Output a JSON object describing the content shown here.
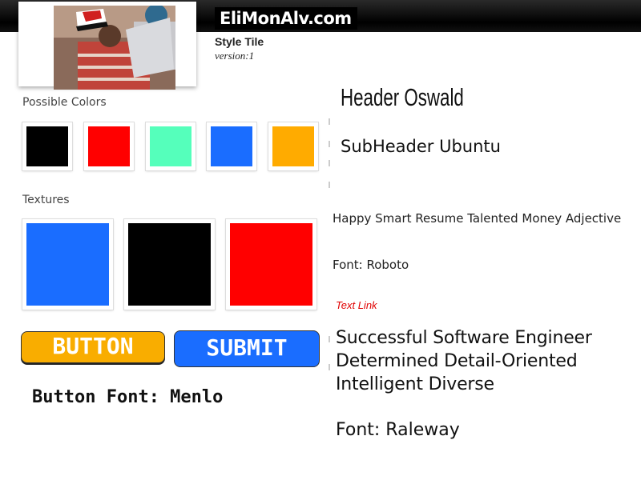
{
  "header": {
    "site_title": "EliMonAlv.com"
  },
  "style_tile": {
    "name": "Style Tile",
    "version": "version:1"
  },
  "colors": {
    "label": "Possible Colors",
    "swatches": [
      {
        "name": "black",
        "hex": "#000000"
      },
      {
        "name": "red",
        "hex": "#ff0000"
      },
      {
        "name": "mint",
        "hex": "#55ffbb"
      },
      {
        "name": "blue",
        "hex": "#1a6dff"
      },
      {
        "name": "orange",
        "hex": "#ffab00"
      }
    ]
  },
  "textures": {
    "label": "Textures",
    "swatches": [
      {
        "name": "blue",
        "hex": "#1a6dff"
      },
      {
        "name": "black",
        "hex": "#000000"
      },
      {
        "name": "red",
        "hex": "#ff0000"
      }
    ]
  },
  "buttons": {
    "button_label": "BUTTON",
    "submit_label": "SUBMIT",
    "button_color": "#f9ad00",
    "submit_color": "#1a6dff",
    "font_label": "Button Font: Menlo"
  },
  "typography": {
    "header": "Header Oswald",
    "subheader": "SubHeader Ubuntu",
    "body_words": "Happy Smart Resume Talented Money Adjective",
    "body_font": "Font: Roboto",
    "text_link": "Text Link",
    "raleway_lines": [
      "Successful Software Engineer",
      "Determined Detail-Oriented",
      "Intelligent Diverse"
    ],
    "raleway_font": "Font: Raleway"
  }
}
